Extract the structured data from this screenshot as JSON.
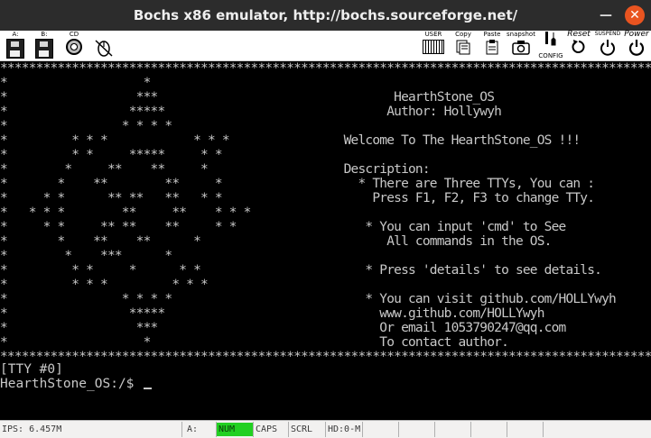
{
  "window": {
    "title": "Bochs x86 emulator, http://bochs.sourceforge.net/",
    "minimize_glyph": "—",
    "close_glyph": "✕"
  },
  "toolbar": {
    "floppy_a_label": "A:",
    "floppy_b_label": "B:",
    "cdrom_label": "CD",
    "user_label": "USER",
    "copy_label": "Copy",
    "paste_label": "Paste",
    "snapshot_label": "snapshot",
    "config_label": "CONFIG",
    "reset_label": "Reset",
    "suspend_label": "SUSPEND",
    "power_label": "Power",
    "icons": [
      "floppy-icon",
      "floppy-icon",
      "cdrom-icon",
      "mouse-icon",
      "keyboard-icon",
      "copy-icon",
      "paste-icon",
      "snapshot-icon",
      "config-icon",
      "reset-icon",
      "suspend-icon",
      "power-icon"
    ]
  },
  "screen": {
    "frame_text": "****************************************************************************************************\n*                   *                                                                              *\n*                  ***                                 HearthStone_OS                              *\n*                 *****                               Author: Hollywyh                             *\n*                * * * *                                                                           *\n*         * * *            * * *                Welcome To The HearthStone_OS !!!                  *\n*         * *     *****     * *                                                                    *\n*        *     **    **     *                   Description:                                       *\n*       *    **        **     *                   * There are Three TTYs, You can :                *\n*     * *      ** **   **   * *                     Press F1, F2, F3 to change TTy.                *\n*   * * *        **     **    * * *                                                                *\n*     * *     ** **    **     * *                  * You can input 'cmd' to See                    *\n*       *    **    **      *                          All commands in the OS.                      *\n*        *    ***      *                                                                           *\n*         * *     *      * *                       * Press 'details' to see details.               *\n*         * * *         * * *                                                                      *\n*                * * * *                           * You can visit github.com/HOLLYwyh             *\n*                 *****                              www.github.com/HOLLYwyh                       *\n*                  ***                               Or email 1053790247@qq.com                    *\n*                   *                                To contact author.                            *\n****************************************************************************************************",
    "tty_line": "[TTY #0]",
    "prompt_line": "HearthStone_OS:/$ "
  },
  "statusbar": {
    "ips": "IPS: 6.457M",
    "drive": "A:",
    "num": "NUM",
    "caps": "CAPS",
    "scrl": "SCRL",
    "hd": "HD:0-M",
    "num_active_color": "#22d022"
  }
}
